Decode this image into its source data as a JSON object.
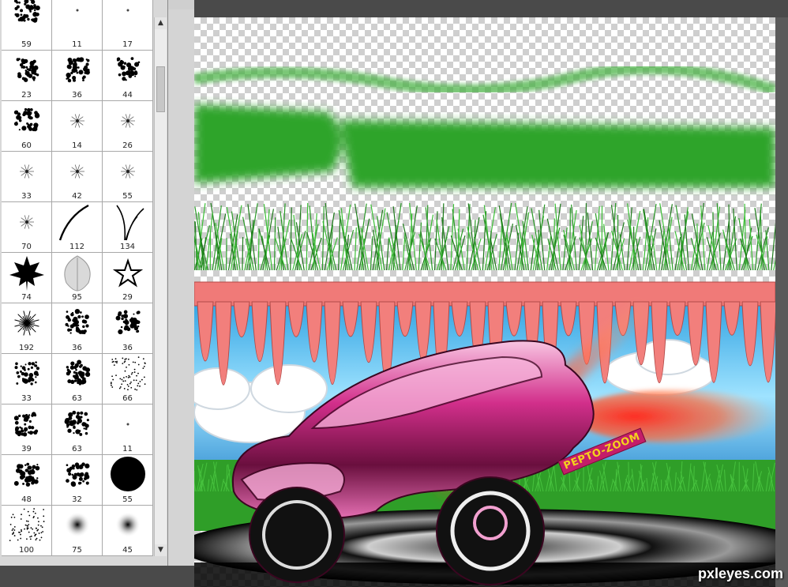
{
  "brush_panel": {
    "presets": [
      {
        "size": "59",
        "icon": "splatter-brush-icon"
      },
      {
        "size": "11",
        "icon": "dot-brush-icon"
      },
      {
        "size": "17",
        "icon": "dot-brush-icon"
      },
      {
        "size": "23",
        "icon": "splatter-brush-icon"
      },
      {
        "size": "36",
        "icon": "splatter-brush-icon"
      },
      {
        "size": "44",
        "icon": "splatter-brush-icon"
      },
      {
        "size": "60",
        "icon": "splatter-brush-icon"
      },
      {
        "size": "14",
        "icon": "star-burst-brush-icon"
      },
      {
        "size": "26",
        "icon": "star-burst-brush-icon"
      },
      {
        "size": "33",
        "icon": "star-burst-brush-icon"
      },
      {
        "size": "42",
        "icon": "star-burst-brush-icon"
      },
      {
        "size": "55",
        "icon": "star-burst-brush-icon"
      },
      {
        "size": "70",
        "icon": "star-burst-brush-icon"
      },
      {
        "size": "112",
        "icon": "grass-blade-brush-icon"
      },
      {
        "size": "134",
        "icon": "grass-blades-brush-icon"
      },
      {
        "size": "74",
        "icon": "maple-leaf-brush-icon"
      },
      {
        "size": "95",
        "icon": "leaf-brush-icon"
      },
      {
        "size": "29",
        "icon": "star-outline-brush-icon"
      },
      {
        "size": "192",
        "icon": "spiky-burst-brush-icon"
      },
      {
        "size": "36",
        "icon": "splatter-brush-icon"
      },
      {
        "size": "36",
        "icon": "splatter-brush-icon"
      },
      {
        "size": "33",
        "icon": "splatter-brush-icon"
      },
      {
        "size": "63",
        "icon": "splatter-brush-icon"
      },
      {
        "size": "66",
        "icon": "scatter-dots-brush-icon"
      },
      {
        "size": "39",
        "icon": "splatter-brush-icon"
      },
      {
        "size": "63",
        "icon": "splatter-brush-icon"
      },
      {
        "size": "11",
        "icon": "dot-brush-icon"
      },
      {
        "size": "48",
        "icon": "splatter-brush-icon"
      },
      {
        "size": "32",
        "icon": "splatter-brush-icon"
      },
      {
        "size": "55",
        "icon": "hard-round-brush-icon"
      },
      {
        "size": "100",
        "icon": "scatter-dots-brush-icon"
      },
      {
        "size": "75",
        "icon": "soft-round-brush-icon"
      },
      {
        "size": "45",
        "icon": "soft-round-brush-icon"
      }
    ]
  },
  "canvas": {
    "badge_text": "PEPTO-ZOOM",
    "watermark": "pxleyes.com"
  },
  "colors": {
    "grass": "#2ea42b",
    "icicle": "#f07a78",
    "car": "#d6358f",
    "sky": "#2aa6e0",
    "flame": "#f03a2c"
  }
}
